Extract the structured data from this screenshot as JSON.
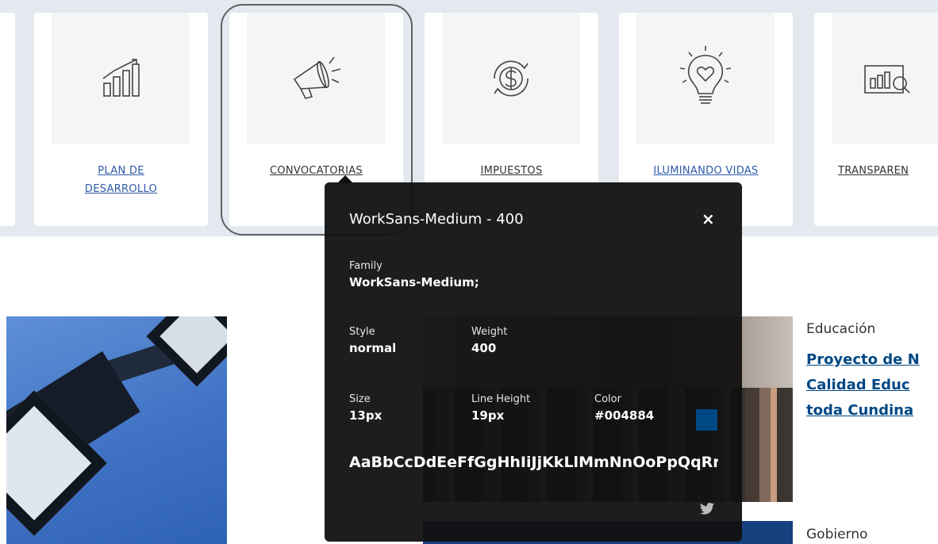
{
  "quick_links": [
    {
      "label_line1": "PLAN DE",
      "label_line2": "DESARROLLO",
      "icon": "bar-chart-icon"
    },
    {
      "label_line1": "CONVOCATORIAS",
      "label_line2": "",
      "icon": "megaphone-icon"
    },
    {
      "label_line1": "IMPUESTOS",
      "label_line2": "",
      "icon": "dollar-coin-icon"
    },
    {
      "label_line1": "ILUMINANDO VIDAS",
      "label_line2": "",
      "icon": "lightbulb-heart-icon"
    },
    {
      "label_line1": "TRANSPAREN",
      "label_line2": "",
      "icon": "chart-magnifier-icon"
    }
  ],
  "inspector": {
    "title": "WorkSans-Medium - 400",
    "close": "×",
    "family_label": "Family",
    "family_value": "WorkSans-Medium;",
    "style_label": "Style",
    "style_value": "normal",
    "weight_label": "Weight",
    "weight_value": "400",
    "size_label": "Size",
    "size_value": "13px",
    "line_height_label": "Line Height",
    "line_height_value": "19px",
    "color_label": "Color",
    "color_value": "#004884",
    "sample": "AaBbCcDdEeFfGgHhIiJjKkLlMmNnOoPpQqRrSsTtUuVvWwXxYyZz",
    "social_icon": "twitter-icon"
  },
  "news": [
    {
      "category": "Educación",
      "title_lines": [
        "Proyecto de N",
        "Calidad Educ",
        "toda Cundina"
      ]
    },
    {
      "category": "Gobierno"
    }
  ],
  "colors": {
    "link_blue": "#2d5aa8",
    "headline_blue": "#004884",
    "band": "#e3e9ef"
  }
}
